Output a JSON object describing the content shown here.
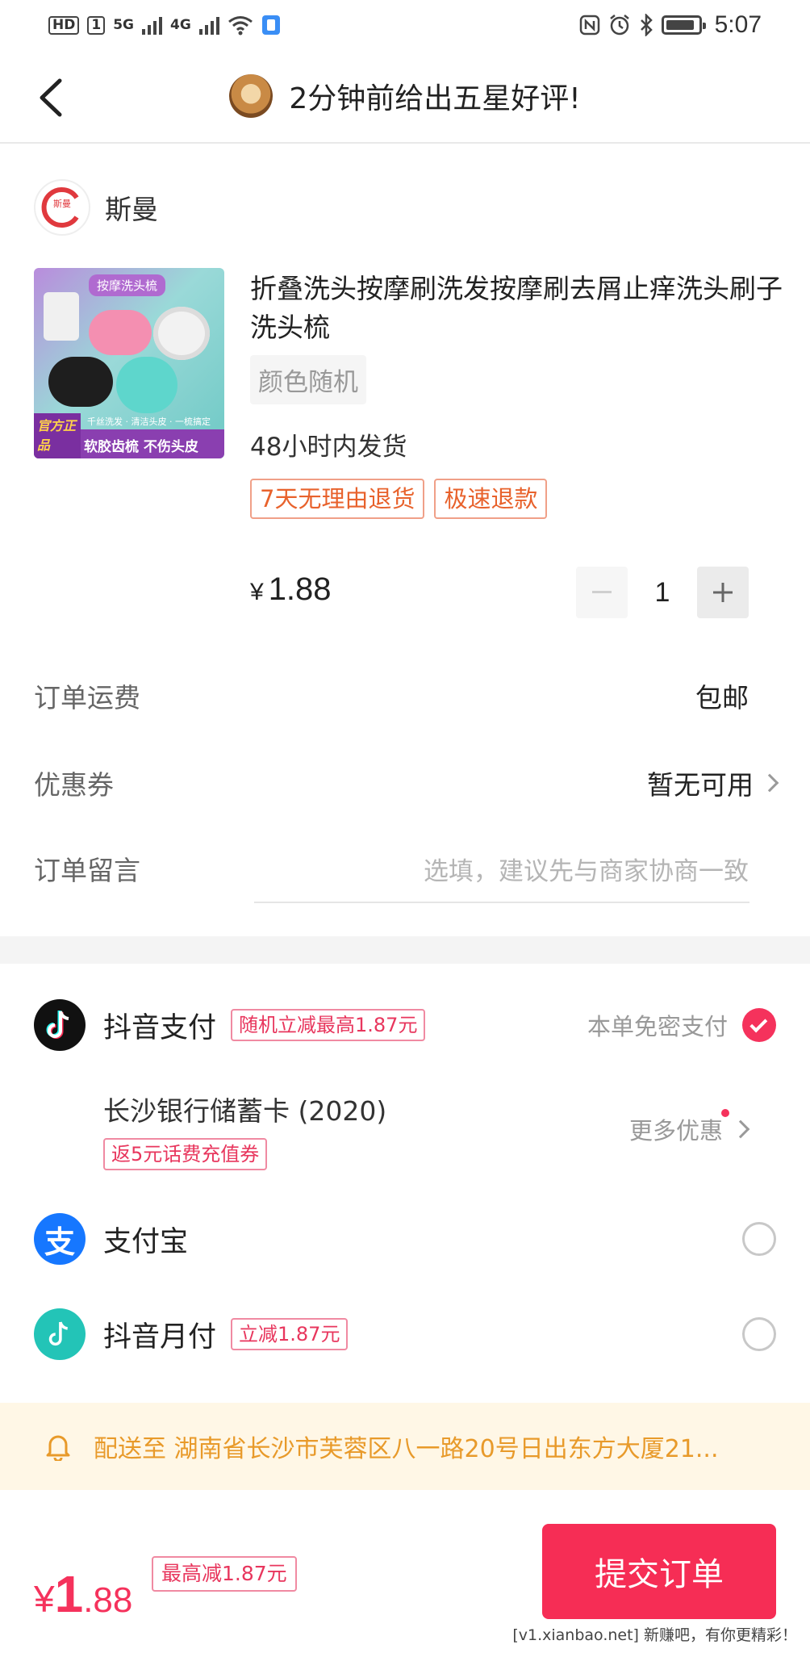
{
  "status_bar": {
    "left_chips": [
      "HD",
      "1"
    ],
    "network_1": "5G",
    "network_2": "4G",
    "time": "5:07"
  },
  "nav": {
    "title": "2分钟前给出五星好评!"
  },
  "shop": {
    "logo_text": "斯曼",
    "name": "斯曼"
  },
  "product": {
    "image": {
      "top_label": "按摩洗头梳",
      "badge": "官方正品",
      "sub_text": "千丝洗发 · 清洁头皮 · 一梳搞定",
      "bottom_text": "软胶齿梳 不伤头皮"
    },
    "title": "折叠洗头按摩刷洗发按摩刷去屑止痒洗头刷子洗头梳",
    "spec": "颜色随机",
    "shipping": "48小时内发货",
    "tags": [
      "7天无理由退货",
      "极速退款"
    ],
    "price_symbol": "¥",
    "price": "1.88",
    "quantity": "1"
  },
  "order": {
    "freight_label": "订单运费",
    "freight_value": "包邮",
    "coupon_label": "优惠券",
    "coupon_value": "暂无可用",
    "note_label": "订单留言",
    "note_placeholder": "选填，建议先与商家协商一致"
  },
  "payments": {
    "douyin": {
      "name": "抖音支付",
      "tag": "随机立减最高1.87元",
      "hint": "本单免密支付",
      "selected": true
    },
    "bank": {
      "name": "长沙银行储蓄卡 (2020)",
      "tag": "返5元话费充值券",
      "more": "更多优惠"
    },
    "alipay": {
      "name": "支付宝",
      "icon_glyph": "支",
      "selected": false
    },
    "monthly": {
      "name": "抖音月付",
      "tag": "立减1.87元",
      "selected": false
    }
  },
  "delivery": {
    "text": "配送至 湖南省长沙市芙蓉区八一路20号日出东方大厦21..."
  },
  "footer": {
    "yen": "¥",
    "total_int": "1",
    "total_dec": ".88",
    "discount": "最高减1.87元",
    "submit": "提交订单",
    "watermark": "[v1.xianbao.net] 新赚吧，有你更精彩！"
  },
  "colors": {
    "accent": "#f62d55",
    "tag_orange": "#e8622c",
    "notice_bg": "#fff7e6",
    "notice_text": "#e89a2a",
    "alipay_blue": "#1677ff",
    "douyin_black": "#111111",
    "monthly_teal": "#23c4b7"
  },
  "icons": [
    "back-arrow-icon",
    "bell-icon",
    "douyin-logo-icon",
    "alipay-logo-icon",
    "monthly-pay-icon",
    "check-icon",
    "chevron-right-icon",
    "wifi-icon",
    "nfc-icon",
    "alarm-icon",
    "bluetooth-icon",
    "battery-icon"
  ]
}
